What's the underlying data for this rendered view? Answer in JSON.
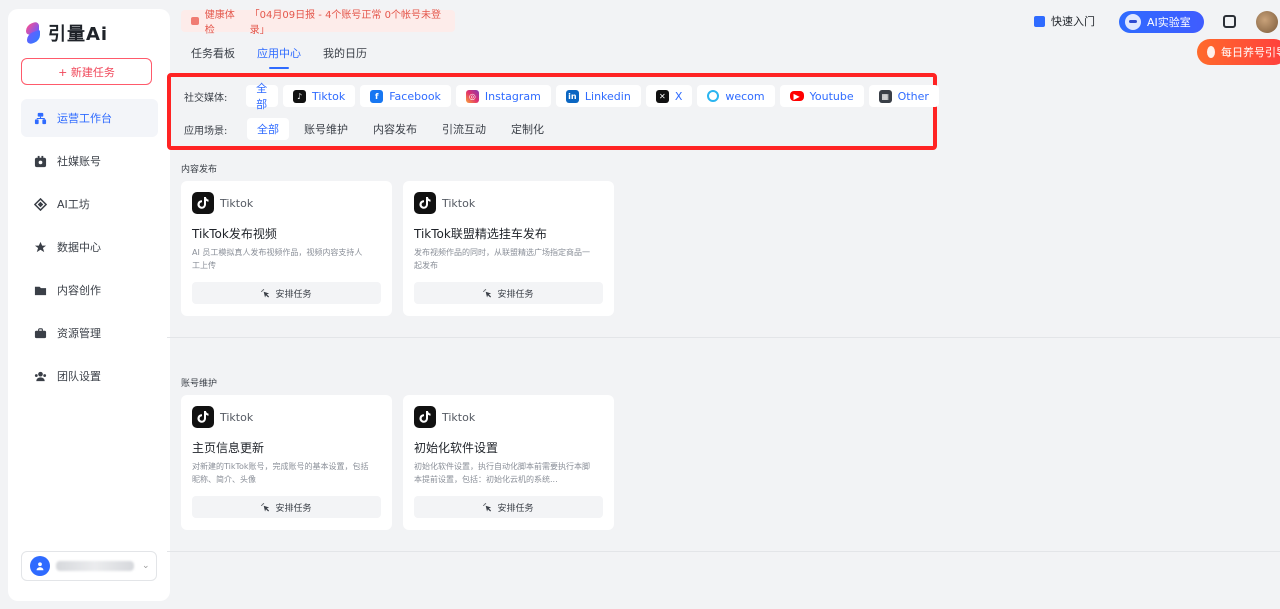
{
  "brand": {
    "name": "引量Ai"
  },
  "sidebar": {
    "new_task": "+ 新建任务",
    "items": [
      {
        "label": "运营工作台",
        "icon": "workbench-icon",
        "active": true
      },
      {
        "label": "社媒账号",
        "icon": "social-account-icon"
      },
      {
        "label": "AI工坊",
        "icon": "ai-workshop-icon"
      },
      {
        "label": "数据中心",
        "icon": "data-center-icon"
      },
      {
        "label": "内容创作",
        "icon": "folder-icon"
      },
      {
        "label": "资源管理",
        "icon": "briefcase-icon"
      },
      {
        "label": "团队设置",
        "icon": "team-icon"
      }
    ]
  },
  "alert": {
    "label": "健康体检",
    "message": "「04月09日报 - 4个账号正常 0个帐号未登录」"
  },
  "header": {
    "quick_start": "快速入门",
    "ai_lab": "AI实验室",
    "promo": "每日养号引导"
  },
  "tabs": [
    {
      "label": "任务看板"
    },
    {
      "label": "应用中心",
      "active": true
    },
    {
      "label": "我的日历"
    }
  ],
  "filters": {
    "social_label": "社交媒体:",
    "social": [
      {
        "label": "全部",
        "icon": ""
      },
      {
        "label": "Tiktok",
        "icon": "tiktok-icon"
      },
      {
        "label": "Facebook",
        "icon": "facebook-icon"
      },
      {
        "label": "Instagram",
        "icon": "instagram-icon"
      },
      {
        "label": "Linkedin",
        "icon": "linkedin-icon"
      },
      {
        "label": "X",
        "icon": "x-icon"
      },
      {
        "label": "wecom",
        "icon": "wecom-icon"
      },
      {
        "label": "Youtube",
        "icon": "youtube-icon"
      },
      {
        "label": "Other",
        "icon": "other-icon"
      }
    ],
    "scene_label": "应用场景:",
    "scenes": [
      {
        "label": "全部",
        "selected": true
      },
      {
        "label": "账号维护"
      },
      {
        "label": "内容发布"
      },
      {
        "label": "引流互动"
      },
      {
        "label": "定制化"
      }
    ]
  },
  "sections": [
    {
      "title": "内容发布",
      "cards": [
        {
          "platform": "Tiktok",
          "title": "TikTok发布视频",
          "desc": "AI 员工模拟真人发布视频作品，视频内容支持人工上传",
          "button": "安排任务"
        },
        {
          "platform": "Tiktok",
          "title": "TikTok联盟精选挂车发布",
          "desc": "发布视频作品的同时，从联盟精选广场指定商品一起发布",
          "button": "安排任务"
        }
      ]
    },
    {
      "title": "账号维护",
      "cards": [
        {
          "platform": "Tiktok",
          "title": "主页信息更新",
          "desc": "对新建的TikTok账号，完成账号的基本设置，包括昵称、简介、头像",
          "button": "安排任务"
        },
        {
          "platform": "Tiktok",
          "title": "初始化软件设置",
          "desc": "初始化软件设置，执行自动化脚本前需要执行本脚本提前设置，包括：初始化云机的系统...",
          "button": "安排任务"
        }
      ]
    }
  ]
}
